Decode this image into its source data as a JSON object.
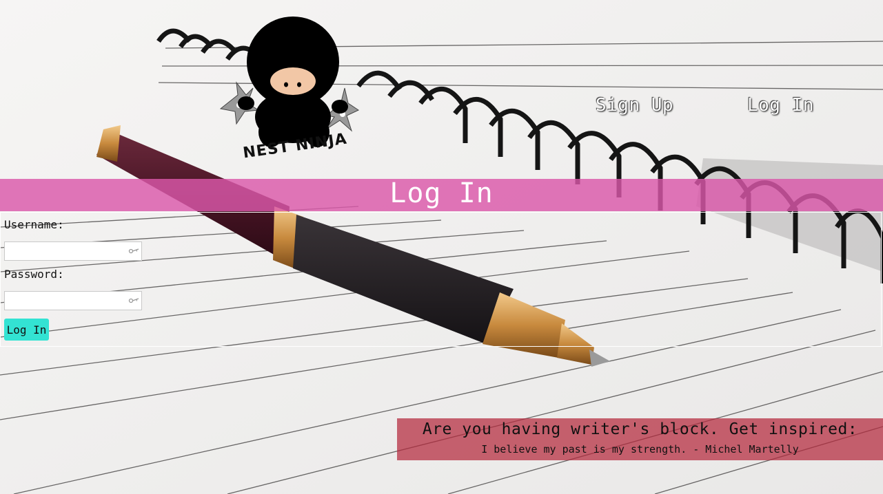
{
  "brand": {
    "logo_text": "NEST NINJA",
    "accent": "#da58aa",
    "button": "#33e3d3"
  },
  "nav": {
    "signup_label": "Sign Up",
    "login_label": "Log In"
  },
  "page": {
    "title": "Log In"
  },
  "form": {
    "username_label": "Username:",
    "username_value": "",
    "password_label": "Password:",
    "password_value": "",
    "submit_label": "Log In",
    "key_icon": "key-icon"
  },
  "quote": {
    "heading": "Are you having writer's block. Get inspired:",
    "text": "I believe my past is my strength. - Michel Martelly"
  }
}
